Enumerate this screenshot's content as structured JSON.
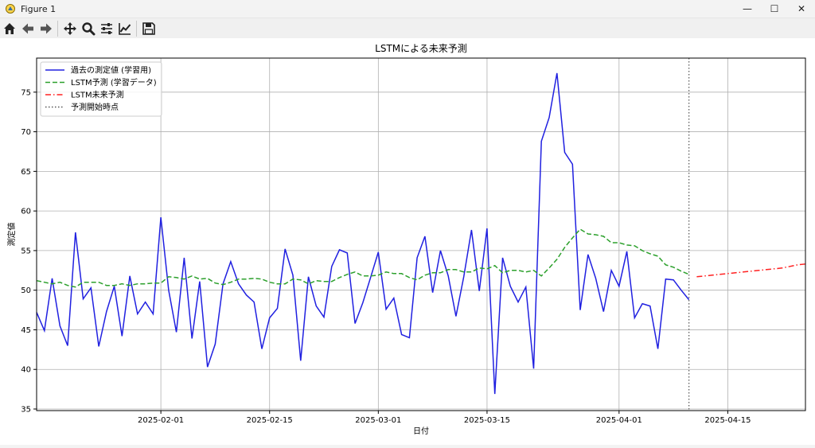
{
  "window": {
    "title": "Figure 1",
    "controls": {
      "minimize": "—",
      "maximize": "☐",
      "close": "✕"
    }
  },
  "toolbar": {
    "buttons": [
      "home-icon",
      "back-icon",
      "forward-icon",
      "pan-icon",
      "zoom-icon",
      "configure-icon",
      "edit-axis-icon",
      "save-icon"
    ]
  },
  "chart_data": {
    "type": "line",
    "title": "LSTMによる未来予測",
    "xlabel": "日付",
    "ylabel": "測定値",
    "xlim": [
      "2025-01-16",
      "2025-04-25"
    ],
    "ylim": [
      34.8,
      79.3
    ],
    "xticks": [
      "2025-02-01",
      "2025-02-15",
      "2025-03-01",
      "2025-03-15",
      "2025-04-01",
      "2025-04-15"
    ],
    "yticks": [
      35,
      40,
      45,
      50,
      55,
      60,
      65,
      70,
      75
    ],
    "grid": true,
    "legend_position": "top-left",
    "vline": {
      "x": "2025-04-10",
      "name": "予測開始時点",
      "color": "#555555"
    },
    "series": [
      {
        "name": "過去の測定値 (学習用)",
        "color": "#2020e0",
        "style": "solid",
        "start": "2025-01-16",
        "values": [
          47.2,
          44.9,
          51.5,
          45.5,
          43.0,
          57.3,
          48.9,
          50.3,
          42.9,
          47.3,
          50.5,
          44.2,
          51.8,
          47.0,
          48.5,
          47.0,
          59.2,
          50.0,
          44.7,
          54.1,
          43.9,
          51.1,
          40.3,
          43.2,
          50.8,
          53.6,
          50.8,
          49.4,
          48.5,
          42.6,
          46.5,
          47.7,
          55.2,
          51.9,
          41.1,
          51.7,
          48.0,
          46.6,
          53.0,
          55.1,
          54.7,
          45.8,
          48.4,
          51.6,
          54.8,
          47.6,
          49.0,
          44.4,
          44.0,
          54.1,
          56.8,
          49.7,
          55.0,
          51.8,
          46.7,
          51.7,
          57.6,
          49.9,
          57.8,
          36.9,
          54.1,
          50.5,
          48.5,
          50.4,
          40.1,
          68.8,
          71.8,
          77.4,
          67.4,
          65.9,
          47.5,
          54.5,
          51.5,
          47.3,
          52.5,
          50.5,
          54.9,
          46.5,
          48.3,
          48.0,
          42.6,
          51.4,
          51.3,
          50.0,
          48.8
        ]
      },
      {
        "name": "LSTM予測 (学習データ)",
        "color": "#2ca02c",
        "style": "dashed",
        "start": "2025-01-16",
        "values": [
          51.2,
          51.0,
          50.8,
          51.0,
          50.6,
          50.4,
          51.0,
          51.0,
          51.0,
          50.6,
          50.6,
          50.8,
          50.6,
          50.8,
          50.8,
          50.9,
          50.9,
          51.7,
          51.6,
          51.4,
          51.8,
          51.4,
          51.5,
          50.9,
          50.7,
          51.0,
          51.4,
          51.4,
          51.5,
          51.4,
          51.0,
          50.8,
          50.8,
          51.4,
          51.3,
          50.8,
          51.2,
          51.1,
          51.1,
          51.6,
          52.0,
          52.3,
          51.8,
          51.8,
          51.9,
          52.3,
          52.1,
          52.1,
          51.6,
          51.3,
          51.9,
          52.2,
          52.2,
          52.6,
          52.6,
          52.3,
          52.3,
          52.8,
          52.7,
          53.1,
          52.2,
          52.5,
          52.5,
          52.3,
          52.5,
          51.8,
          52.8,
          53.9,
          55.4,
          56.6,
          57.7,
          57.1,
          57.0,
          56.8,
          56.0,
          56.0,
          55.7,
          55.6,
          55.0,
          54.6,
          54.3,
          53.2,
          52.9,
          52.4,
          52.0
        ]
      },
      {
        "name": "LSTM未来予測",
        "color": "#ff2020",
        "style": "dashdot",
        "start": "2025-04-11",
        "values": [
          51.7,
          51.8,
          51.9,
          52.0,
          52.1,
          52.2,
          52.3,
          52.4,
          52.5,
          52.6,
          52.7,
          52.8,
          53.0,
          53.2,
          53.3
        ]
      }
    ]
  }
}
